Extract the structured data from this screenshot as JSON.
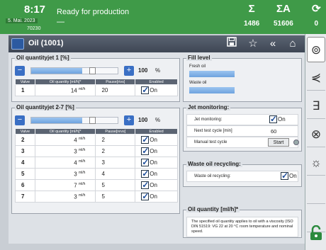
{
  "header": {
    "time": "8:17",
    "date": "5. Mai. 2023",
    "code": "70230",
    "status_line1": "Ready for production",
    "status_line2": "—",
    "counters": [
      {
        "icon": "Σ",
        "value": "1486"
      },
      {
        "icon": "ΣA",
        "value": "51606"
      },
      {
        "icon": "⟳",
        "value": "0"
      }
    ]
  },
  "window": {
    "title": "Oil (1001)"
  },
  "jet1": {
    "title": "Oil quantityjet 1 [%]",
    "value": "100",
    "unit": "%",
    "level": 1.0,
    "columns": [
      "Valve",
      "Oil quantity [ml/h]*",
      "Pause[rivs]",
      "Enabled"
    ],
    "rows": [
      {
        "valve": "1",
        "qty": "14",
        "qty_unit": "ml/h",
        "pause": "20",
        "enabled": "On"
      }
    ]
  },
  "jet27": {
    "title": "Oil quantityjet 2-7 [%]",
    "value": "100",
    "unit": "%",
    "level": 1.0,
    "columns": [
      "Valve",
      "Oil quantity [ml/h]*",
      "Pause[revs]",
      "Enabled"
    ],
    "rows": [
      {
        "valve": "2",
        "qty": "4",
        "qty_unit": "ml/h",
        "pause": "2",
        "enabled": "On"
      },
      {
        "valve": "3",
        "qty": "3",
        "qty_unit": "ml/h",
        "pause": "2",
        "enabled": "On"
      },
      {
        "valve": "4",
        "qty": "4",
        "qty_unit": "ml/h",
        "pause": "3",
        "enabled": "On"
      },
      {
        "valve": "5",
        "qty": "3",
        "qty_unit": "ml/h",
        "pause": "4",
        "enabled": "On"
      },
      {
        "valve": "6",
        "qty": "7",
        "qty_unit": "ml/h",
        "pause": "5",
        "enabled": "On"
      },
      {
        "valve": "7",
        "qty": "3",
        "qty_unit": "ml/h",
        "pause": "5",
        "enabled": "On"
      }
    ]
  },
  "fill_level": {
    "title": "Fill level",
    "fresh_label": "Fresh oil",
    "waste_label": "Waste oil"
  },
  "jet_monitoring": {
    "title": "Jet monitoring:",
    "monitoring_label": "Jet monitoring:",
    "monitoring_value": "On",
    "next_label": "Next test cycle [min]",
    "next_value": "60",
    "manual_label": "Manual test cycle",
    "start_label": "Start"
  },
  "recycling": {
    "title": "Waste oil recycling:",
    "label": "Waste oil recycling:",
    "value": "On"
  },
  "oil_quantity": {
    "title": "Oil quantity [ml/h]*",
    "desc": "The specified oil quantity applies to oil with a viscosity (ISO DIN 51519: VG 22 at 20 °C room temperature and nominal speed."
  },
  "colors": {
    "topbar": "#3f9a48",
    "accent": "#3a6fc4",
    "header": "#5b6472"
  }
}
